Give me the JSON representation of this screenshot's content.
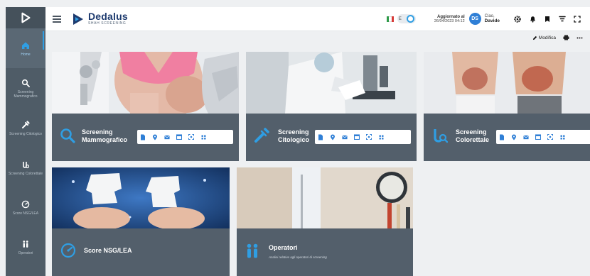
{
  "sidebar": {
    "logo": "dedalus-play-icon",
    "items": [
      {
        "label": "Home",
        "icon": "home-icon",
        "active": true
      },
      {
        "label": "Screening Mammografico",
        "icon": "search-icon"
      },
      {
        "label": "Screening Citologico",
        "icon": "pipette-icon"
      },
      {
        "label": "Screening Colorettale",
        "icon": "magnifier-tube-icon"
      },
      {
        "label": "Score NSG/LEA",
        "icon": "gauge-icon"
      },
      {
        "label": "Operatori",
        "icon": "people-icon"
      }
    ]
  },
  "header": {
    "brand_name": "Dedalus",
    "brand_sub": "SHAH SCREENING",
    "language_toggle_label": "E",
    "updated_label": "Aggiornato al",
    "updated_value": "26/04/2023 04:12",
    "avatar_initials": "DS",
    "greeting": "Ciao,",
    "user_name": "Davide",
    "icons": [
      "gear-icon",
      "bell-icon",
      "bookmark-icon",
      "funnel-icon",
      "fullscreen-icon"
    ]
  },
  "toolbar": {
    "edit_label": "Modifica",
    "icons": [
      "print-icon",
      "more-icon"
    ]
  },
  "cards": [
    {
      "title_l1": "Screening",
      "title_l2": "Mammografico",
      "description": "",
      "icon": "search-icon",
      "has_actions": true
    },
    {
      "title_l1": "Screening",
      "title_l2": "Citologico",
      "description": "",
      "icon": "pipette-icon",
      "has_actions": true
    },
    {
      "title_l1": "Screening",
      "title_l2": "Colorettale",
      "description": "",
      "icon": "magnifier-tube-icon",
      "has_actions": true
    },
    {
      "title_l1": "Score NSG/LEA",
      "title_l2": "",
      "description": "",
      "icon": "gauge-icon",
      "has_actions": false
    },
    {
      "title_l1": "Operatori",
      "title_l2": "",
      "description": "Analisi relative agli operatori di screening",
      "icon": "people-icon",
      "has_actions": false
    }
  ],
  "card_action_icons": [
    "document-icon",
    "location-pin-icon",
    "mail-icon",
    "calendar-icon",
    "scan-icon",
    "grid-icon"
  ],
  "colors": {
    "sidebar": "#4f5c67",
    "card": "#535f6b",
    "accent": "#2f9ee3",
    "brand": "#1e3b6f"
  }
}
